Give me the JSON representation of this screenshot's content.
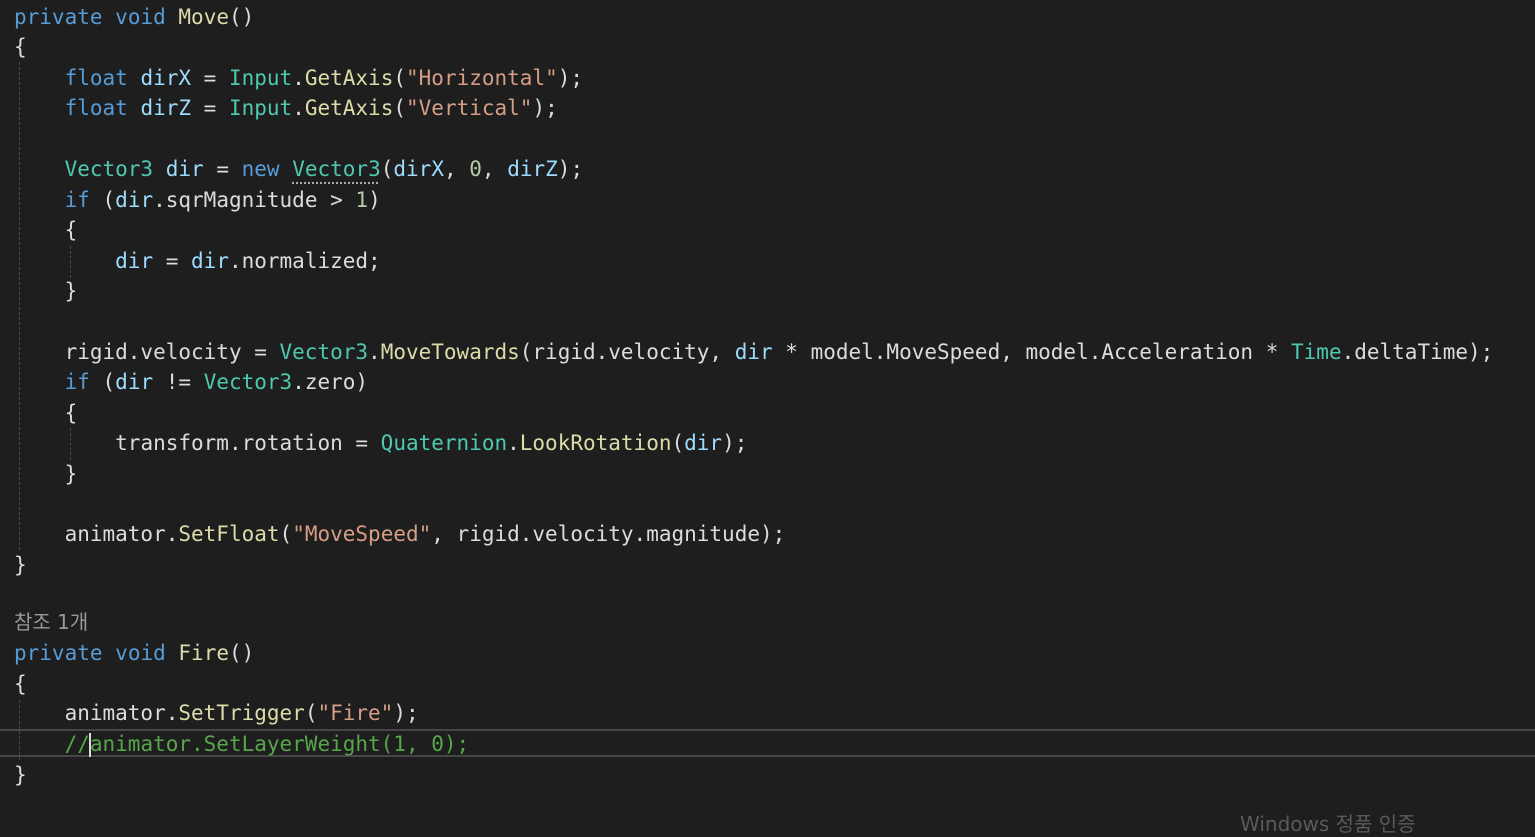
{
  "editor": {
    "codelens_fire": "참조 1개",
    "lines": {
      "l1": [
        "private",
        " ",
        "void",
        " ",
        "Move",
        "()"
      ],
      "l2": "{",
      "l3": [
        "float",
        " ",
        "dirX",
        " = ",
        "Input",
        ".",
        "GetAxis",
        "(",
        "\"Horizontal\"",
        ");"
      ],
      "l4": [
        "float",
        " ",
        "dirZ",
        " = ",
        "Input",
        ".",
        "GetAxis",
        "(",
        "\"Vertical\"",
        ");"
      ],
      "l5": [
        "Vector3",
        " ",
        "dir",
        " = ",
        "new",
        " ",
        "Vector3",
        "(",
        "dirX",
        ", ",
        "0",
        ", ",
        "dirZ",
        ");"
      ],
      "l6": [
        "if",
        " (",
        "dir",
        ".sqrMagnitude > ",
        "1",
        ")"
      ],
      "l7": "{",
      "l8": [
        "dir",
        " = ",
        "dir",
        ".normalized;"
      ],
      "l9": "}",
      "l10": [
        "rigid.velocity = ",
        "Vector3",
        ".",
        "MoveTowards",
        "(rigid.velocity, ",
        "dir",
        " * model.MoveSpeed, model.Acceleration * ",
        "Time",
        ".deltaTime);"
      ],
      "l11": [
        "if",
        " (",
        "dir",
        " != ",
        "Vector3",
        ".zero)"
      ],
      "l12": "{",
      "l13": [
        "transform.rotation = ",
        "Quaternion",
        ".",
        "LookRotation",
        "(",
        "dir",
        ");"
      ],
      "l14": "}",
      "l15": [
        "animator.",
        "SetFloat",
        "(",
        "\"MoveSpeed\"",
        ", rigid.velocity.magnitude);"
      ],
      "l16": "}",
      "l17": [
        "private",
        " ",
        "void",
        " ",
        "Fire",
        "()"
      ],
      "l18": "{",
      "l19": [
        "animator.",
        "SetTrigger",
        "(",
        "\"Fire\"",
        ");"
      ],
      "l20": [
        "//",
        "animator.SetLayerWeight(1, 0);"
      ],
      "l21": "}"
    }
  },
  "watermark": "Windows 정품 인증",
  "colors": {
    "background": "#1e1e1e",
    "keyword": "#569cd6",
    "type": "#4ec9b0",
    "method": "#dcdcaa",
    "string": "#d69d85",
    "number": "#b5cea8",
    "variable": "#9cdcfe",
    "comment": "#57a64a",
    "text": "#dcdcdc"
  }
}
